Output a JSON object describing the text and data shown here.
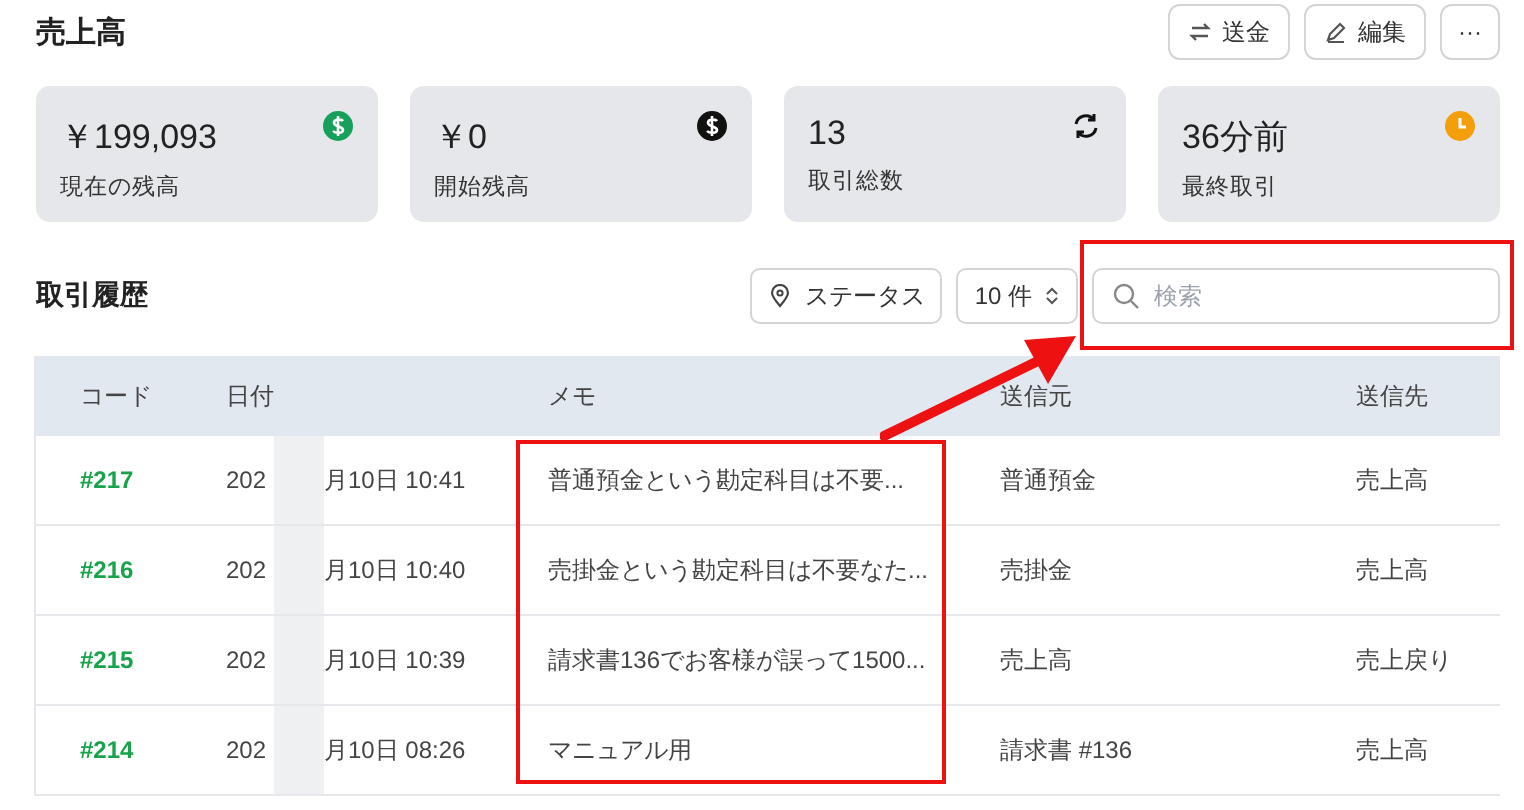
{
  "page_title": "売上高",
  "actions": [
    {
      "kind": "transfer",
      "label": "送金"
    },
    {
      "kind": "edit",
      "label": "編集"
    },
    {
      "kind": "more",
      "label": "···"
    }
  ],
  "cards": [
    {
      "value": "￥199,093",
      "label": "現在の残高"
    },
    {
      "value": "￥0",
      "label": "開始残高"
    },
    {
      "value": "13",
      "label": "取引総数"
    },
    {
      "value": "36分前",
      "label": "最終取引"
    }
  ],
  "history": {
    "title": "取引履歴",
    "status_filter": "ステータス",
    "page_size": "10 件",
    "search": {
      "placeholder": "検索"
    }
  },
  "table": {
    "columns": [
      "コード",
      "日付",
      "メモ",
      "送信元",
      "送信先"
    ],
    "rows": [
      {
        "code": "#217",
        "date_start": "202",
        "date_end": "月10日 10:41",
        "memo": "普通預金という勘定科目は不要...",
        "from": "普通預金",
        "to": "売上高"
      },
      {
        "code": "#216",
        "date_start": "202",
        "date_end": "月10日 10:40",
        "memo": "売掛金という勘定科目は不要なた...",
        "from": "売掛金",
        "to": "売上高"
      },
      {
        "code": "#215",
        "date_start": "202",
        "date_end": "月10日 10:39",
        "memo": "請求書136でお客様が誤って1500...",
        "from": "売上高",
        "to": "売上戻り"
      },
      {
        "code": "#214",
        "date_start": "202",
        "date_end": "月10日 08:26",
        "memo": "マニュアル用",
        "from": "請求書 #136",
        "to": "売上高"
      }
    ]
  },
  "annotations": [
    {
      "kind": "box"
    },
    {
      "kind": "box"
    },
    {
      "kind": "arrow"
    }
  ]
}
